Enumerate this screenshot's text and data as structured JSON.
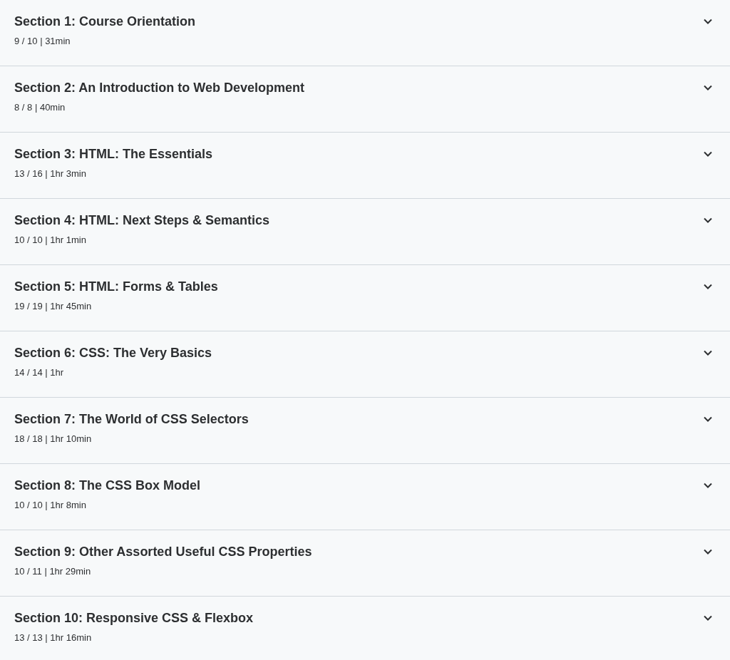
{
  "sections": [
    {
      "title": "Section 1: Course Orientation",
      "meta": "9 / 10 | 31min",
      "expanded": false
    },
    {
      "title": "Section 2: An Introduction to Web Development",
      "meta": "8 / 8 | 40min",
      "expanded": false
    },
    {
      "title": "Section 3: HTML: The Essentials",
      "meta": "13 / 16 | 1hr 3min",
      "expanded": false
    },
    {
      "title": "Section 4: HTML: Next Steps & Semantics",
      "meta": "10 / 10 | 1hr 1min",
      "expanded": false
    },
    {
      "title": "Section 5: HTML: Forms & Tables",
      "meta": "19 / 19 | 1hr 45min",
      "expanded": false
    },
    {
      "title": "Section 6: CSS: The Very Basics",
      "meta": "14 / 14 | 1hr",
      "expanded": false
    },
    {
      "title": "Section 7: The World of CSS Selectors",
      "meta": "18 / 18 | 1hr 10min",
      "expanded": false
    },
    {
      "title": "Section 8: The CSS Box Model",
      "meta": "10 / 10 | 1hr 8min",
      "expanded": false
    },
    {
      "title": "Section 9: Other Assorted Useful CSS Properties",
      "meta": "10 / 11 | 1hr 29min",
      "expanded": false
    },
    {
      "title": "Section 10: Responsive CSS & Flexbox",
      "meta": "13 / 13 | 1hr 16min",
      "expanded": false
    }
  ]
}
